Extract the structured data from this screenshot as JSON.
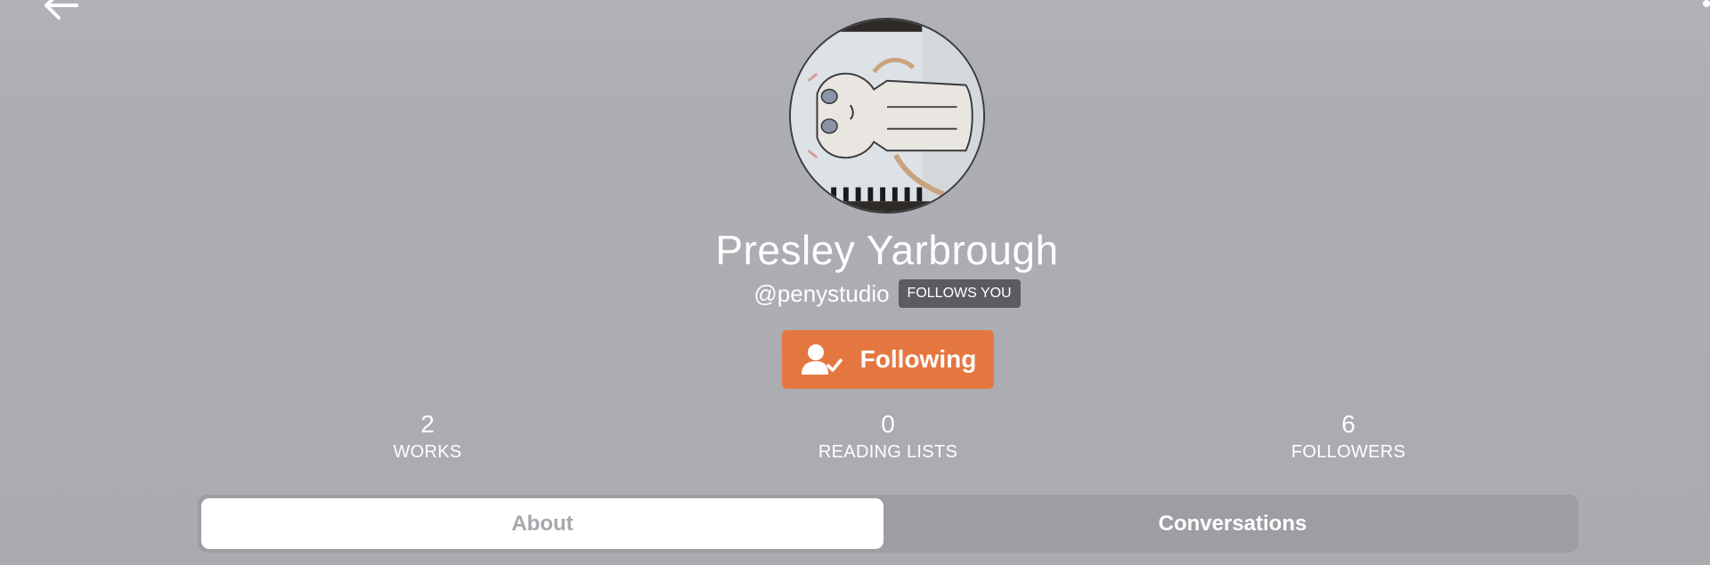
{
  "profile": {
    "name": "Presley Yarbrough",
    "handle": "@penystudio",
    "follows_badge": "FOLLOWS YOU"
  },
  "follow_button": {
    "label": "Following",
    "color": "#e47740"
  },
  "stats": [
    {
      "value": "2",
      "label": "WORKS"
    },
    {
      "value": "0",
      "label": "READING LISTS"
    },
    {
      "value": "6",
      "label": "FOLLOWERS"
    }
  ],
  "tabs": [
    {
      "label": "About",
      "active": true
    },
    {
      "label": "Conversations",
      "active": false
    }
  ],
  "icons": {
    "back": "arrow-left-icon",
    "follow": "user-check-icon",
    "menu": "more-icon"
  }
}
